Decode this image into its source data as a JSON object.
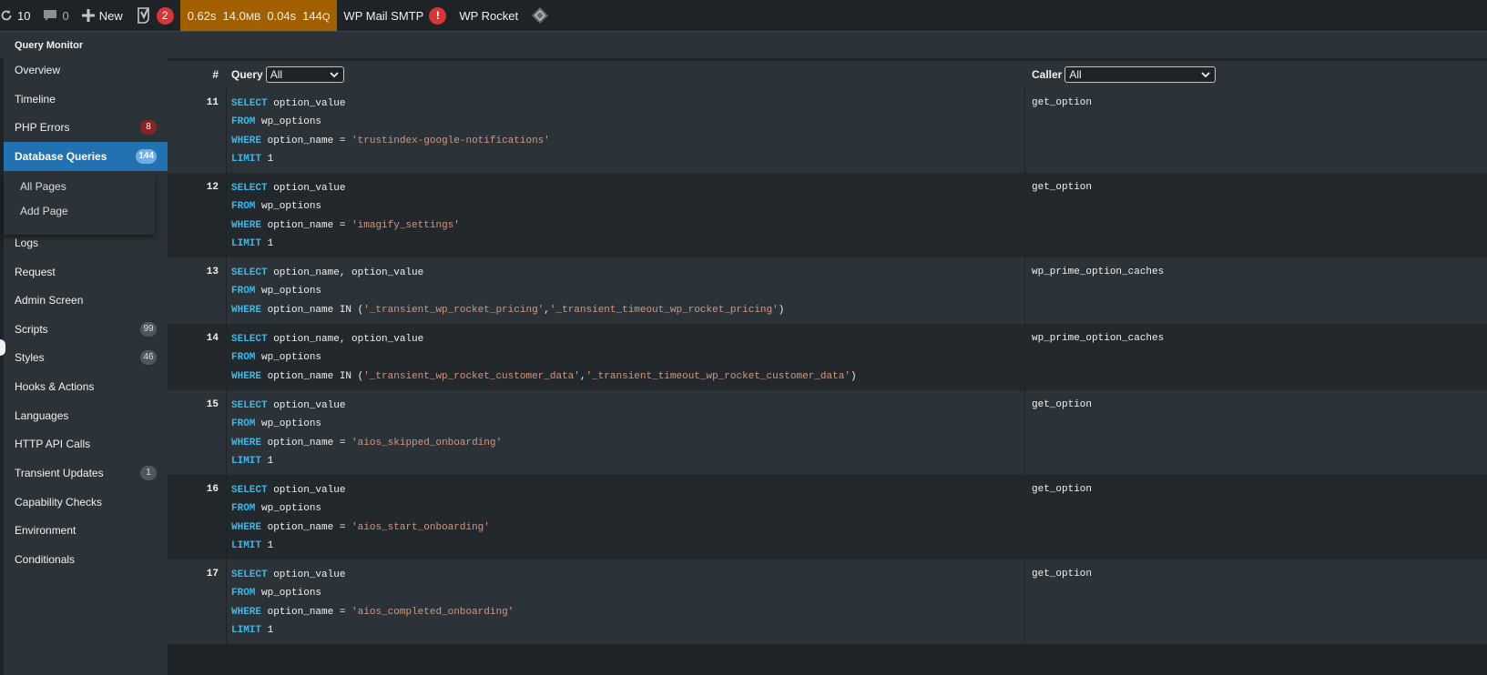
{
  "admin_bar": {
    "updates_count": "10",
    "comments_count": "0",
    "new_label": "New",
    "yoast_badge": "2",
    "qm_time": "0.62s",
    "qm_memory": "14.0",
    "qm_memory_unit": "MB",
    "qm_db_time": "0.04s",
    "qm_queries": "144",
    "qm_queries_unit": "Q",
    "smtp_label": "WP Mail SMTP",
    "smtp_alert": "!",
    "rocket_label": "WP Rocket"
  },
  "panel": {
    "title": "Query Monitor"
  },
  "nav": {
    "items": [
      {
        "label": "Overview",
        "count": ""
      },
      {
        "label": "Timeline",
        "count": ""
      },
      {
        "label": "PHP Errors",
        "count": "8"
      },
      {
        "label": "Database Queries",
        "count": "144"
      },
      {
        "label": "Logs",
        "count": ""
      },
      {
        "label": "Request",
        "count": ""
      },
      {
        "label": "Admin Screen",
        "count": ""
      },
      {
        "label": "Scripts",
        "count": "99"
      },
      {
        "label": "Styles",
        "count": "46"
      },
      {
        "label": "Hooks & Actions",
        "count": ""
      },
      {
        "label": "Languages",
        "count": ""
      },
      {
        "label": "HTTP API Calls",
        "count": ""
      },
      {
        "label": "Transient Updates",
        "count": "1"
      },
      {
        "label": "Capability Checks",
        "count": ""
      },
      {
        "label": "Environment",
        "count": ""
      },
      {
        "label": "Conditionals",
        "count": ""
      }
    ],
    "flyout": [
      "All Pages",
      "Add Page"
    ]
  },
  "table": {
    "col_num": "#",
    "col_query": "Query",
    "query_filter": "All",
    "col_caller": "Caller",
    "caller_filter": "All",
    "rows": [
      {
        "num": "11",
        "lines": [
          [
            [
              "kw",
              "SELECT"
            ],
            [
              "t",
              " option_value"
            ]
          ],
          [
            [
              "kw",
              "FROM"
            ],
            [
              "t",
              " wp_options"
            ]
          ],
          [
            [
              "kw",
              "WHERE"
            ],
            [
              "t",
              " option_name = "
            ],
            [
              "str",
              "'trustindex-google-notifications'"
            ]
          ],
          [
            [
              "kw",
              "LIMIT"
            ],
            [
              "t",
              " 1"
            ]
          ]
        ],
        "caller": "get_option"
      },
      {
        "num": "12",
        "lines": [
          [
            [
              "kw",
              "SELECT"
            ],
            [
              "t",
              " option_value"
            ]
          ],
          [
            [
              "kw",
              "FROM"
            ],
            [
              "t",
              " wp_options"
            ]
          ],
          [
            [
              "kw",
              "WHERE"
            ],
            [
              "t",
              " option_name = "
            ],
            [
              "str",
              "'imagify_settings'"
            ]
          ],
          [
            [
              "kw",
              "LIMIT"
            ],
            [
              "t",
              " 1"
            ]
          ]
        ],
        "caller": "get_option"
      },
      {
        "num": "13",
        "lines": [
          [
            [
              "kw",
              "SELECT"
            ],
            [
              "t",
              " option_name, option_value"
            ]
          ],
          [
            [
              "kw",
              "FROM"
            ],
            [
              "t",
              " wp_options"
            ]
          ],
          [
            [
              "kw",
              "WHERE"
            ],
            [
              "t",
              " option_name IN ("
            ],
            [
              "str",
              "'_transient_wp_rocket_pricing'"
            ],
            [
              "t",
              ","
            ],
            [
              "str",
              "'_transient_timeout_wp_rocket_pricing'"
            ],
            [
              "t",
              ")"
            ]
          ]
        ],
        "caller": "wp_prime_option_caches"
      },
      {
        "num": "14",
        "lines": [
          [
            [
              "kw",
              "SELECT"
            ],
            [
              "t",
              " option_name, option_value"
            ]
          ],
          [
            [
              "kw",
              "FROM"
            ],
            [
              "t",
              " wp_options"
            ]
          ],
          [
            [
              "kw",
              "WHERE"
            ],
            [
              "t",
              " option_name IN ("
            ],
            [
              "str",
              "'_transient_wp_rocket_customer_data'"
            ],
            [
              "t",
              ","
            ],
            [
              "str",
              "'_transient_timeout_wp_rocket_customer_data'"
            ],
            [
              "t",
              ")"
            ]
          ]
        ],
        "caller": "wp_prime_option_caches"
      },
      {
        "num": "15",
        "lines": [
          [
            [
              "kw",
              "SELECT"
            ],
            [
              "t",
              " option_value"
            ]
          ],
          [
            [
              "kw",
              "FROM"
            ],
            [
              "t",
              " wp_options"
            ]
          ],
          [
            [
              "kw",
              "WHERE"
            ],
            [
              "t",
              " option_name = "
            ],
            [
              "str",
              "'aios_skipped_onboarding'"
            ]
          ],
          [
            [
              "kw",
              "LIMIT"
            ],
            [
              "t",
              " 1"
            ]
          ]
        ],
        "caller": "get_option"
      },
      {
        "num": "16",
        "lines": [
          [
            [
              "kw",
              "SELECT"
            ],
            [
              "t",
              " option_value"
            ]
          ],
          [
            [
              "kw",
              "FROM"
            ],
            [
              "t",
              " wp_options"
            ]
          ],
          [
            [
              "kw",
              "WHERE"
            ],
            [
              "t",
              " option_name = "
            ],
            [
              "str",
              "'aios_start_onboarding'"
            ]
          ],
          [
            [
              "kw",
              "LIMIT"
            ],
            [
              "t",
              " 1"
            ]
          ]
        ],
        "caller": "get_option"
      },
      {
        "num": "17",
        "lines": [
          [
            [
              "kw",
              "SELECT"
            ],
            [
              "t",
              " option_value"
            ]
          ],
          [
            [
              "kw",
              "FROM"
            ],
            [
              "t",
              " wp_options"
            ]
          ],
          [
            [
              "kw",
              "WHERE"
            ],
            [
              "t",
              " option_name = "
            ],
            [
              "str",
              "'aios_completed_onboarding'"
            ]
          ],
          [
            [
              "kw",
              "LIMIT"
            ],
            [
              "t",
              " 1"
            ]
          ]
        ],
        "caller": "get_option"
      }
    ]
  }
}
